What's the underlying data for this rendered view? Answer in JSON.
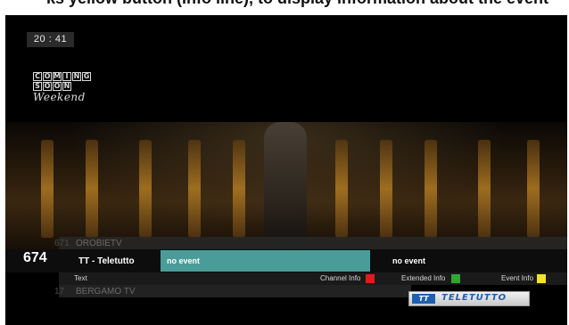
{
  "caption": "ks yellow button (Info line), to display information about the event",
  "clock": "20 : 41",
  "program_logo": {
    "line1": "COMING",
    "line2": "SOON",
    "line3": "Weekend"
  },
  "channels": {
    "previous": {
      "number": "671",
      "name": "OROBIETV"
    },
    "current": {
      "number": "674",
      "name": "TT - Teletutto"
    },
    "next": {
      "number": "17",
      "name": "BERGAMO TV"
    }
  },
  "events": {
    "now": "no event",
    "next": "no event"
  },
  "help_bar": {
    "text": "Text",
    "channel_info": "Channel Info",
    "extended_info": "Extended Info",
    "event_info": "Event Info"
  },
  "colors": {
    "red_key": "#e01b1b",
    "green_key": "#2ea82e",
    "yellow_key": "#f5e12a",
    "event_highlight": "#4a9c99"
  },
  "channel_logo": {
    "mark": "TT",
    "word": "TELETUTTO"
  }
}
